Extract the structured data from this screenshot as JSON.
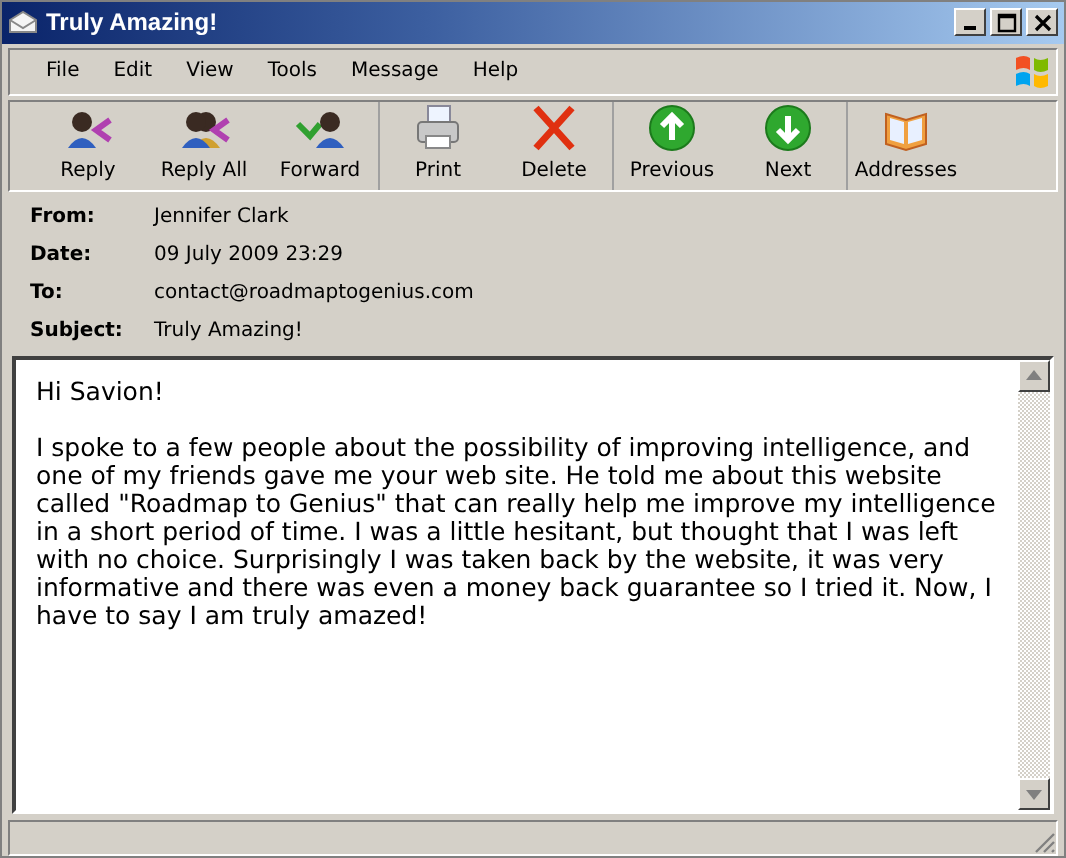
{
  "window": {
    "title": "Truly Amazing!",
    "controls": [
      {
        "kind": "minimize"
      },
      {
        "kind": "maximize"
      },
      {
        "kind": "close"
      }
    ]
  },
  "menu": [
    "File",
    "Edit",
    "View",
    "Tools",
    "Message",
    "Help"
  ],
  "toolbar": [
    [
      {
        "label": "Reply",
        "kind": "reply"
      },
      {
        "label": "Reply All",
        "kind": "reply_all"
      },
      {
        "label": "Forward",
        "kind": "forward"
      }
    ],
    [
      {
        "label": "Print",
        "kind": "print"
      },
      {
        "label": "Delete",
        "kind": "delete"
      }
    ],
    [
      {
        "label": "Previous",
        "kind": "previous"
      },
      {
        "label": "Next",
        "kind": "next"
      }
    ],
    [
      {
        "label": "Addresses",
        "kind": "addresses"
      }
    ]
  ],
  "headers": [
    {
      "label": "From:",
      "value": "Jennifer Clark"
    },
    {
      "label": "Date:",
      "value": "09 July 2009 23:29"
    },
    {
      "label": "To:",
      "value": "contact@roadmaptogenius.com"
    },
    {
      "label": "Subject:",
      "value": "Truly Amazing!"
    }
  ],
  "body": [
    "Hi Savion!",
    "I spoke to a few people about the possibility of improving intelligence, and one of my friends gave me your web site. He told me about this website called \"Roadmap to Genius\" that can really help me improve my intelligence in a short period of time. I was a little hesitant, but thought that I was left with no choice. Surprisingly I was taken back by the website, it was very informative and there was even a money back guarantee so I tried it. Now, I have to say I am truly amazed!"
  ]
}
